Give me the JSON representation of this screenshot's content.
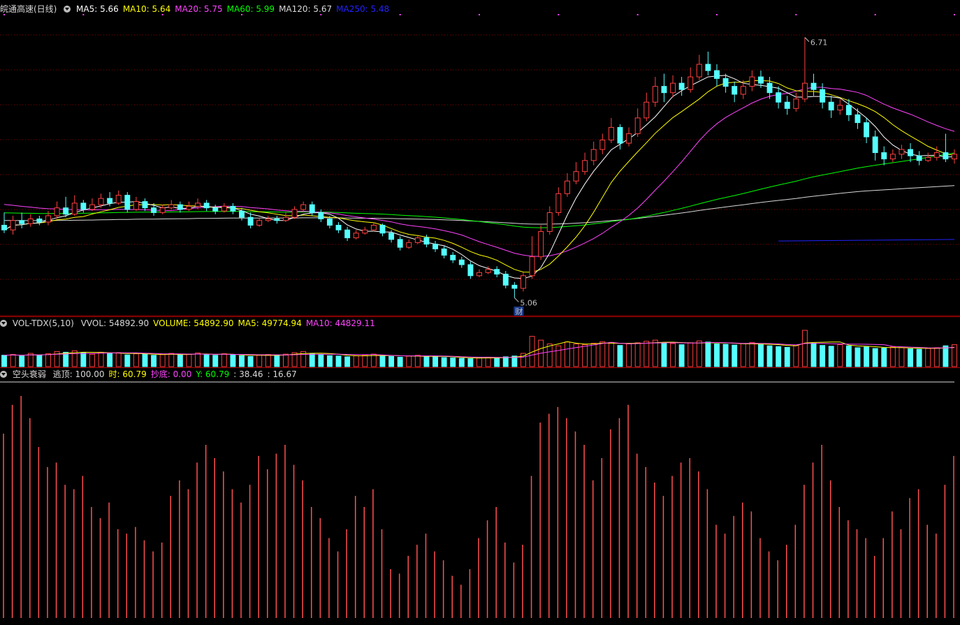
{
  "header": {
    "title": "皖通高速(日线)",
    "ma": [
      {
        "label": "MA5: 5.66",
        "color": "#ffffff"
      },
      {
        "label": "MA10: 5.64",
        "color": "#ffff00"
      },
      {
        "label": "MA20: 5.75",
        "color": "#ff44ff"
      },
      {
        "label": "MA60: 5.99",
        "color": "#00ff00"
      },
      {
        "label": "MA120: 5.67",
        "color": "#d8d8d8"
      },
      {
        "label": "MA250: 5.48",
        "color": "#2222ff"
      }
    ]
  },
  "vol_header": {
    "title": "VOL-TDX(5,10)",
    "items": [
      {
        "label": "VVOL: 54892.90",
        "color": "#d8d8d8"
      },
      {
        "label": "VOLUME: 54892.90",
        "color": "#ffff00"
      },
      {
        "label": "MA5: 49774.94",
        "color": "#ffff00"
      },
      {
        "label": "MA10: 44829.11",
        "color": "#ff44ff"
      }
    ]
  },
  "ind_header": {
    "title": "空头衰弱",
    "items": [
      {
        "label": "逃顶: 100.00",
        "color": "#d8d8d8"
      },
      {
        "label": "时: 60.79",
        "color": "#ffff00"
      },
      {
        "label": "抄底: 0.00",
        "color": "#ff44ff"
      },
      {
        "label": "Y: 60.79",
        "color": "#00ff00"
      },
      {
        "label": ": 38.46",
        "color": "#d8d8d8"
      },
      {
        "label": ": 16.67",
        "color": "#d8d8d8"
      }
    ]
  },
  "annotations": {
    "high": "6.71",
    "low": "5.06",
    "badge": "财"
  },
  "colors": {
    "up": "#ff4040",
    "down": "#54ffff",
    "grid": "#8b0000",
    "ma5": "#ffffff",
    "ma10": "#ffff00",
    "ma20": "#ff44ff",
    "ma60": "#00ff00",
    "ma120": "#d8d8d8",
    "ma250": "#2222ff"
  },
  "chart_data": {
    "type": "candlestick",
    "series_names": [
      "MA5",
      "MA10",
      "MA20",
      "MA60",
      "MA120",
      "MA250"
    ],
    "price_range": [
      5.0,
      6.85
    ],
    "high": 6.71,
    "low": 5.06,
    "candles": [
      [
        5.52,
        5.49,
        5.6,
        5.47
      ],
      [
        5.49,
        5.55,
        5.58,
        5.46
      ],
      [
        5.55,
        5.53,
        5.6,
        5.5
      ],
      [
        5.53,
        5.56,
        5.59,
        5.51
      ],
      [
        5.56,
        5.54,
        5.58,
        5.52
      ],
      [
        5.54,
        5.58,
        5.61,
        5.52
      ],
      [
        5.58,
        5.63,
        5.67,
        5.56
      ],
      [
        5.63,
        5.59,
        5.7,
        5.57
      ],
      [
        5.59,
        5.66,
        5.71,
        5.58
      ],
      [
        5.66,
        5.62,
        5.68,
        5.6
      ],
      [
        5.62,
        5.65,
        5.69,
        5.61
      ],
      [
        5.65,
        5.69,
        5.72,
        5.63
      ],
      [
        5.69,
        5.66,
        5.73,
        5.64
      ],
      [
        5.66,
        5.71,
        5.74,
        5.65
      ],
      [
        5.71,
        5.62,
        5.73,
        5.6
      ],
      [
        5.62,
        5.67,
        5.7,
        5.61
      ],
      [
        5.67,
        5.63,
        5.69,
        5.61
      ],
      [
        5.63,
        5.6,
        5.66,
        5.58
      ],
      [
        5.6,
        5.63,
        5.65,
        5.59
      ],
      [
        5.63,
        5.65,
        5.68,
        5.62
      ],
      [
        5.65,
        5.62,
        5.67,
        5.6
      ],
      [
        5.62,
        5.64,
        5.67,
        5.61
      ],
      [
        5.64,
        5.66,
        5.69,
        5.62
      ],
      [
        5.66,
        5.63,
        5.68,
        5.61
      ],
      [
        5.63,
        5.61,
        5.65,
        5.59
      ],
      [
        5.61,
        5.64,
        5.66,
        5.6
      ],
      [
        5.64,
        5.61,
        5.66,
        5.59
      ],
      [
        5.61,
        5.57,
        5.63,
        5.55
      ],
      [
        5.57,
        5.52,
        5.6,
        5.5
      ],
      [
        5.52,
        5.55,
        5.57,
        5.51
      ],
      [
        5.55,
        5.56,
        5.58,
        5.54
      ],
      [
        5.56,
        5.55,
        5.58,
        5.53
      ],
      [
        5.55,
        5.57,
        5.6,
        5.54
      ],
      [
        5.57,
        5.62,
        5.64,
        5.56
      ],
      [
        5.62,
        5.65,
        5.67,
        5.6
      ],
      [
        5.65,
        5.6,
        5.67,
        5.58
      ],
      [
        5.6,
        5.56,
        5.62,
        5.54
      ],
      [
        5.56,
        5.52,
        5.58,
        5.5
      ],
      [
        5.52,
        5.49,
        5.54,
        5.47
      ],
      [
        5.49,
        5.44,
        5.51,
        5.42
      ],
      [
        5.44,
        5.47,
        5.49,
        5.43
      ],
      [
        5.47,
        5.49,
        5.51,
        5.46
      ],
      [
        5.49,
        5.52,
        5.54,
        5.48
      ],
      [
        5.52,
        5.47,
        5.53,
        5.45
      ],
      [
        5.47,
        5.43,
        5.49,
        5.41
      ],
      [
        5.43,
        5.38,
        5.45,
        5.36
      ],
      [
        5.38,
        5.41,
        5.43,
        5.37
      ],
      [
        5.41,
        5.44,
        5.46,
        5.4
      ],
      [
        5.44,
        5.4,
        5.46,
        5.38
      ],
      [
        5.4,
        5.37,
        5.42,
        5.35
      ],
      [
        5.37,
        5.33,
        5.39,
        5.31
      ],
      [
        5.33,
        5.3,
        5.35,
        5.28
      ],
      [
        5.3,
        5.27,
        5.32,
        5.25
      ],
      [
        5.27,
        5.2,
        5.29,
        5.18
      ],
      [
        5.2,
        5.22,
        5.24,
        5.19
      ],
      [
        5.22,
        5.24,
        5.26,
        5.21
      ],
      [
        5.24,
        5.21,
        5.26,
        5.19
      ],
      [
        5.21,
        5.14,
        5.23,
        5.12
      ],
      [
        5.14,
        5.12,
        5.16,
        5.06
      ],
      [
        5.12,
        5.2,
        5.22,
        5.1
      ],
      [
        5.2,
        5.32,
        5.45,
        5.18
      ],
      [
        5.32,
        5.48,
        5.52,
        5.3
      ],
      [
        5.48,
        5.6,
        5.64,
        5.46
      ],
      [
        5.6,
        5.72,
        5.76,
        5.58
      ],
      [
        5.72,
        5.8,
        5.85,
        5.7
      ],
      [
        5.8,
        5.86,
        5.92,
        5.78
      ],
      [
        5.86,
        5.93,
        5.98,
        5.84
      ],
      [
        5.93,
        6.0,
        6.05,
        5.9
      ],
      [
        6.0,
        6.06,
        6.1,
        5.97
      ],
      [
        6.06,
        6.14,
        6.2,
        6.04
      ],
      [
        6.14,
        6.04,
        6.16,
        6.0
      ],
      [
        6.04,
        6.1,
        6.14,
        6.02
      ],
      [
        6.1,
        6.2,
        6.26,
        6.08
      ],
      [
        6.2,
        6.3,
        6.36,
        6.18
      ],
      [
        6.3,
        6.4,
        6.46,
        6.27
      ],
      [
        6.4,
        6.36,
        6.48,
        6.3
      ],
      [
        6.36,
        6.42,
        6.47,
        6.33
      ],
      [
        6.42,
        6.38,
        6.46,
        6.34
      ],
      [
        6.38,
        6.46,
        6.52,
        6.36
      ],
      [
        6.46,
        6.54,
        6.6,
        6.44
      ],
      [
        6.54,
        6.5,
        6.62,
        6.47
      ],
      [
        6.5,
        6.45,
        6.54,
        6.4
      ],
      [
        6.45,
        6.4,
        6.48,
        6.36
      ],
      [
        6.4,
        6.35,
        6.43,
        6.3
      ],
      [
        6.35,
        6.4,
        6.44,
        6.32
      ],
      [
        6.4,
        6.46,
        6.5,
        6.37
      ],
      [
        6.46,
        6.42,
        6.5,
        6.39
      ],
      [
        6.42,
        6.36,
        6.46,
        6.32
      ],
      [
        6.36,
        6.3,
        6.4,
        6.26
      ],
      [
        6.3,
        6.26,
        6.34,
        6.22
      ],
      [
        6.26,
        6.32,
        6.36,
        6.24
      ],
      [
        6.32,
        6.42,
        6.71,
        6.3
      ],
      [
        6.42,
        6.38,
        6.48,
        6.34
      ],
      [
        6.38,
        6.3,
        6.42,
        6.26
      ],
      [
        6.3,
        6.25,
        6.34,
        6.2
      ],
      [
        6.25,
        6.28,
        6.32,
        6.22
      ],
      [
        6.28,
        6.22,
        6.32,
        6.18
      ],
      [
        6.22,
        6.17,
        6.26,
        6.13
      ],
      [
        6.17,
        6.08,
        6.2,
        6.04
      ],
      [
        6.08,
        5.98,
        6.12,
        5.93
      ],
      [
        5.98,
        5.94,
        6.02,
        5.9
      ],
      [
        5.94,
        5.97,
        6.0,
        5.92
      ],
      [
        5.97,
        6.0,
        6.03,
        5.94
      ],
      [
        6.0,
        5.96,
        6.04,
        5.92
      ],
      [
        5.96,
        5.93,
        5.99,
        5.9
      ],
      [
        5.93,
        5.95,
        5.98,
        5.92
      ],
      [
        5.95,
        5.98,
        6.02,
        5.93
      ],
      [
        5.98,
        5.94,
        6.1,
        5.92
      ],
      [
        5.94,
        5.97,
        6.0,
        5.91
      ]
    ],
    "volume": [
      30,
      32,
      28,
      35,
      30,
      34,
      40,
      38,
      42,
      36,
      33,
      38,
      35,
      37,
      31,
      34,
      33,
      30,
      32,
      35,
      31,
      33,
      36,
      32,
      30,
      34,
      31,
      29,
      27,
      30,
      32,
      31,
      33,
      37,
      40,
      35,
      32,
      29,
      28,
      26,
      29,
      31,
      33,
      28,
      27,
      25,
      28,
      30,
      27,
      26,
      24,
      23,
      22,
      21,
      23,
      25,
      24,
      26,
      28,
      35,
      80,
      70,
      60,
      55,
      65,
      60,
      58,
      62,
      66,
      64,
      56,
      60,
      63,
      67,
      70,
      62,
      61,
      58,
      63,
      68,
      65,
      60,
      59,
      57,
      61,
      64,
      58,
      55,
      53,
      51,
      57,
      96,
      62,
      56,
      54,
      58,
      55,
      50,
      52,
      48,
      49,
      52,
      50,
      47,
      46,
      48,
      50,
      55,
      58
    ],
    "indicator": [
      83,
      96,
      100,
      90,
      77,
      68,
      70,
      60,
      58,
      64,
      50,
      45,
      52,
      40,
      38,
      41,
      35,
      30,
      34,
      55,
      62,
      58,
      70,
      78,
      72,
      66,
      58,
      52,
      60,
      73,
      67,
      74,
      78,
      69,
      62,
      50,
      45,
      36,
      30,
      40,
      55,
      50,
      58,
      40,
      22,
      20,
      28,
      33,
      38,
      30,
      26,
      19,
      15,
      22,
      36,
      44,
      50,
      34,
      25,
      33,
      64,
      88,
      92,
      95,
      90,
      84,
      78,
      62,
      72,
      85,
      90,
      96,
      74,
      68,
      61,
      55,
      64,
      70,
      72,
      66,
      58,
      42,
      38,
      46,
      52,
      48,
      36,
      30,
      26,
      33,
      42,
      60,
      70,
      78,
      62,
      50,
      44,
      40,
      36,
      28,
      36,
      48,
      40,
      54,
      58,
      42,
      38,
      60,
      73
    ]
  }
}
